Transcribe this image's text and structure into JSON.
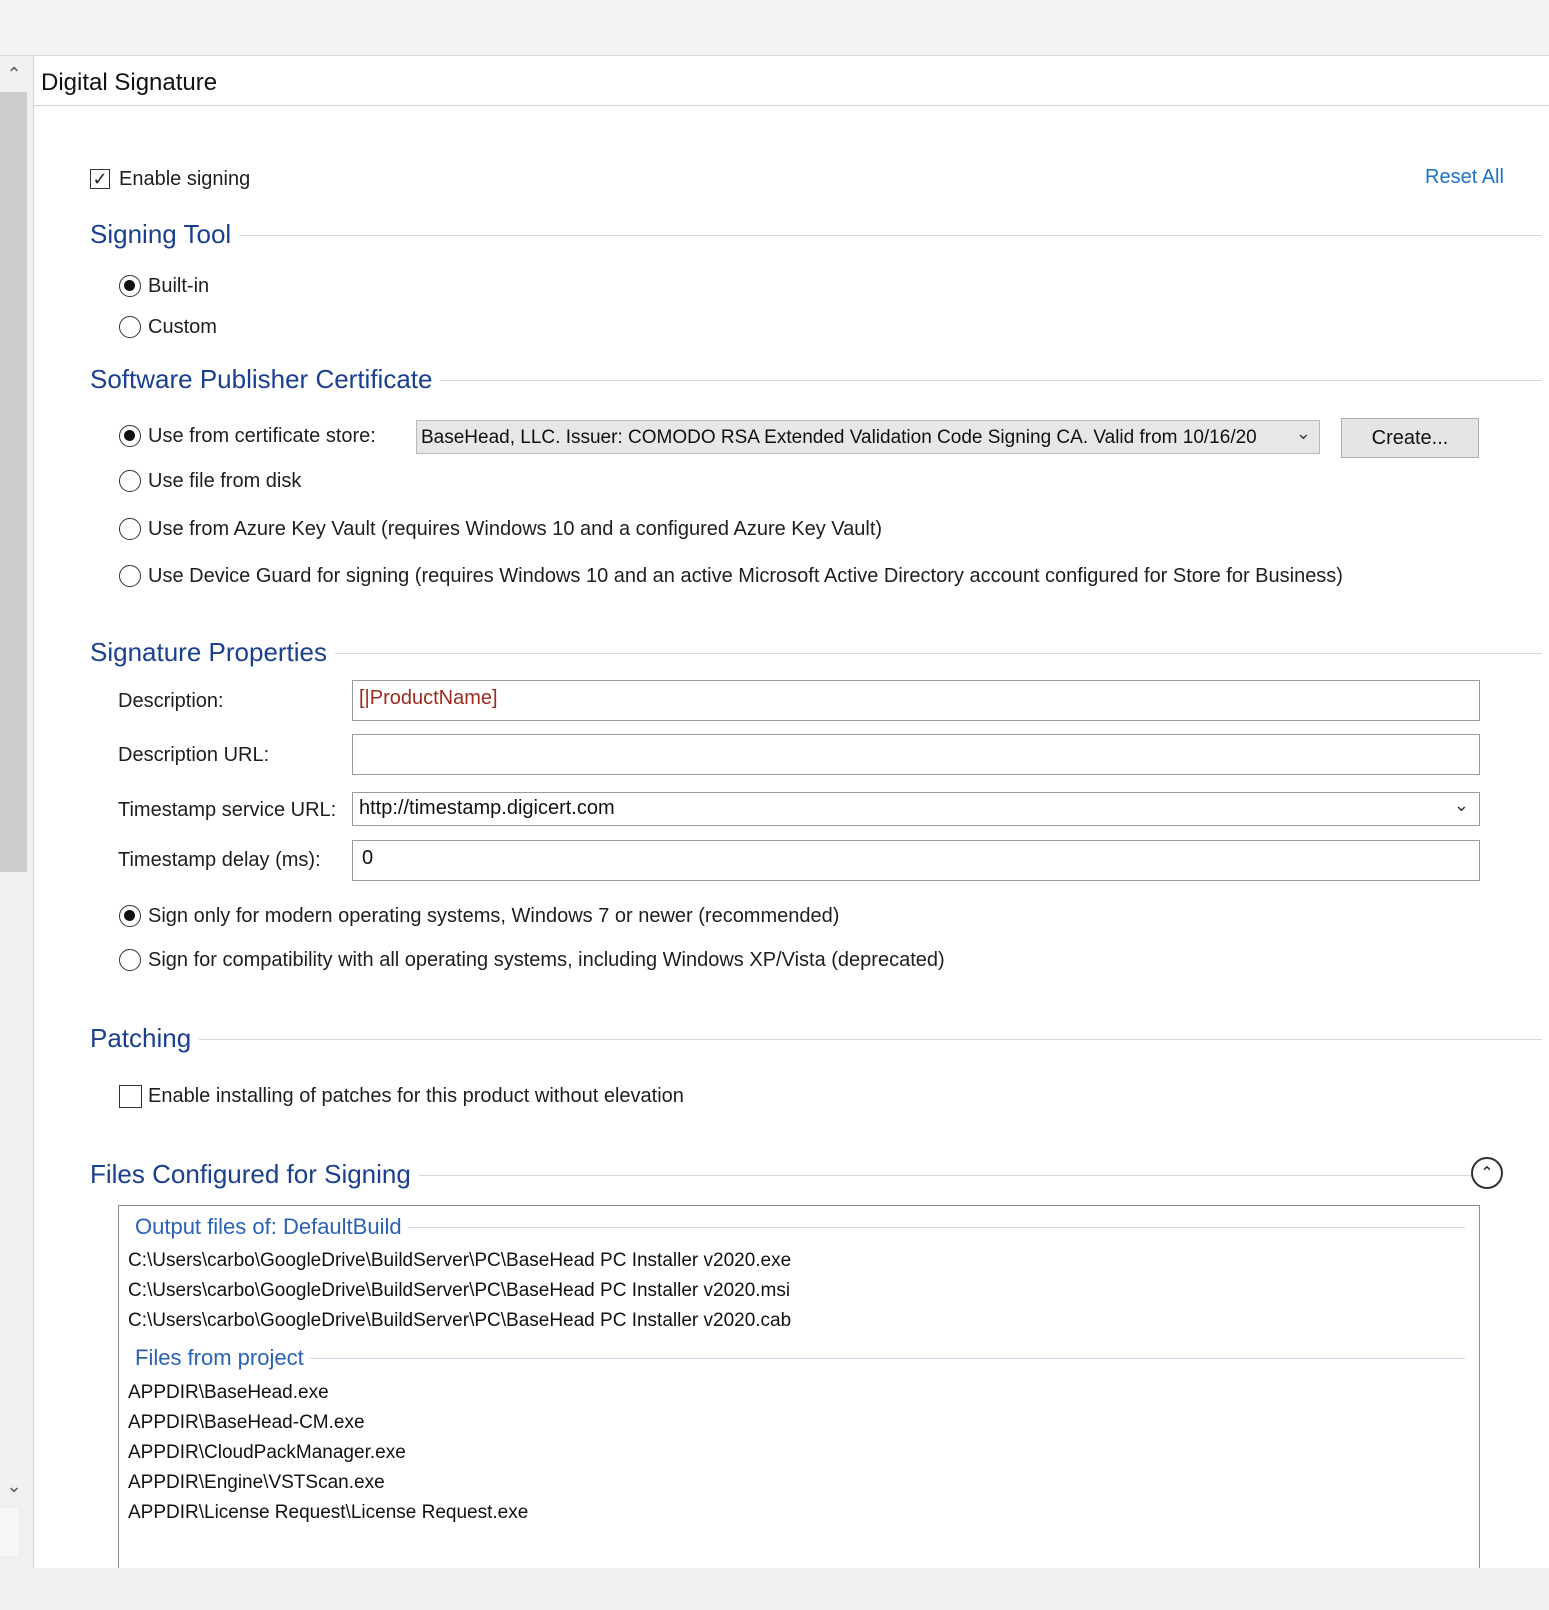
{
  "page": {
    "title": "Digital Signature",
    "enable_signing_label": "Enable signing",
    "enable_signing_checked": true,
    "reset_all_label": "Reset All"
  },
  "signing_tool": {
    "title": "Signing Tool",
    "options": [
      {
        "label": "Built-in",
        "selected": true
      },
      {
        "label": "Custom",
        "selected": false
      }
    ]
  },
  "certificate": {
    "title": "Software Publisher Certificate",
    "options": [
      {
        "label": "Use from certificate store:",
        "selected": true
      },
      {
        "label": "Use file from disk",
        "selected": false
      },
      {
        "label": "Use from Azure Key Vault (requires Windows 10 and a configured Azure Key Vault)",
        "selected": false
      },
      {
        "label": "Use Device Guard for signing (requires Windows 10 and an active Microsoft Active Directory account configured for Store for Business)",
        "selected": false
      }
    ],
    "store_selected": "BaseHead, LLC. Issuer: COMODO RSA Extended Validation Code Signing CA. Valid from 10/16/20",
    "create_button": "Create..."
  },
  "signature_properties": {
    "title": "Signature Properties",
    "description_label": "Description:",
    "description_value": "[|ProductName]",
    "description_url_label": "Description URL:",
    "description_url_value": "",
    "timestamp_url_label": "Timestamp service URL:",
    "timestamp_url_value": "http://timestamp.digicert.com",
    "timestamp_delay_label": "Timestamp delay (ms):",
    "timestamp_delay_value": "0",
    "os_options": [
      {
        "label": "Sign only for modern operating systems, Windows 7 or newer (recommended)",
        "selected": true
      },
      {
        "label": "Sign for compatibility with all operating systems, including Windows XP/Vista (deprecated)",
        "selected": false
      }
    ]
  },
  "patching": {
    "title": "Patching",
    "option_label": "Enable installing of patches for this product without elevation",
    "option_checked": false
  },
  "files": {
    "title": "Files Configured for Signing",
    "groups": [
      {
        "title": "Output files of: DefaultBuild",
        "items": [
          "C:\\Users\\carbo\\GoogleDrive\\BuildServer\\PC\\BaseHead PC Installer v2020.exe",
          "C:\\Users\\carbo\\GoogleDrive\\BuildServer\\PC\\BaseHead PC Installer v2020.msi",
          "C:\\Users\\carbo\\GoogleDrive\\BuildServer\\PC\\BaseHead PC Installer v2020.cab"
        ]
      },
      {
        "title": "Files from project",
        "items": [
          "APPDIR\\BaseHead.exe",
          "APPDIR\\BaseHead-CM.exe",
          "APPDIR\\CloudPackManager.exe",
          "APPDIR\\Engine\\VSTScan.exe",
          "APPDIR\\License Request\\License Request.exe"
        ]
      }
    ]
  },
  "icons": {
    "scroll_up": "chevron-up-icon",
    "scroll_down": "chevron-down-icon",
    "dropdown": "chevron-down-icon",
    "collapse": "chevron-up-circle-icon",
    "checkmark": "check-icon"
  },
  "colors": {
    "section_title": "#1a3f8f",
    "link": "#1a73c9",
    "highlight_value": "#9c2a1e"
  }
}
